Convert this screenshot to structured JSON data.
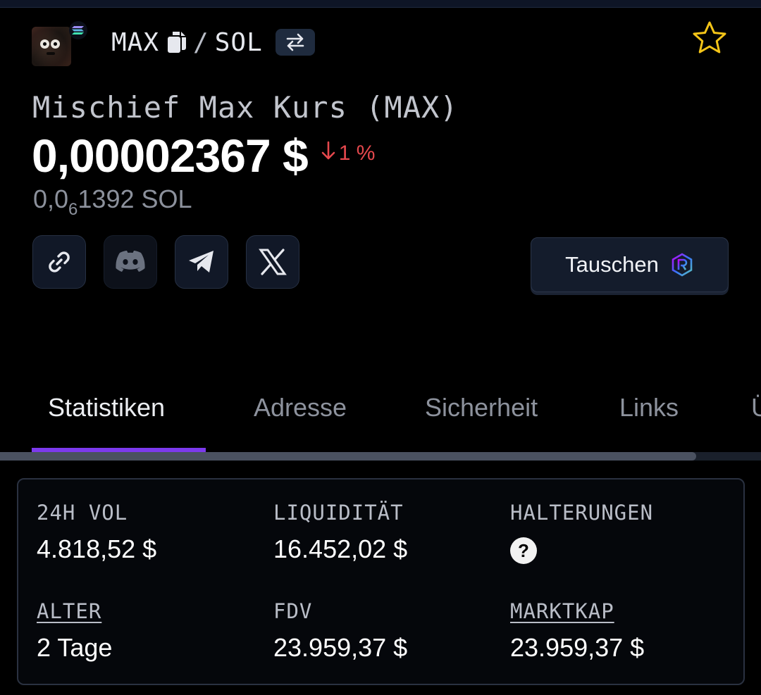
{
  "header": {
    "base_symbol": "MAX",
    "separator": "/",
    "quote_symbol": "SOL"
  },
  "token": {
    "title": "Mischief Max Kurs (MAX)",
    "price": "0,00002367 $",
    "change": "1 %",
    "change_color": "#e5484d",
    "sol_price_prefix": "0,0",
    "sol_price_subscript": "6",
    "sol_price_rest": "1392 SOL"
  },
  "actions": {
    "swap_label": "Tauschen"
  },
  "tabs": [
    {
      "label": "Statistiken",
      "active": true
    },
    {
      "label": "Adresse"
    },
    {
      "label": "Sicherheit"
    },
    {
      "label": "Links"
    },
    {
      "label": "Ü"
    }
  ],
  "stats": {
    "vol24h": {
      "label": "24H VOL",
      "value": "4.818,52 $"
    },
    "liquidity": {
      "label": "LIQUIDITÄT",
      "value": "16.452,02 $"
    },
    "holders": {
      "label": "HALTERUNGEN",
      "value": "?"
    },
    "age": {
      "label": "ALTER",
      "value": "2 Tage"
    },
    "fdv": {
      "label": "FDV",
      "value": "23.959,37 $"
    },
    "marketcap": {
      "label": "MARKTKAP",
      "value": "23.959,37 $"
    }
  },
  "colors": {
    "accent": "#7c3aed",
    "star": "#f5c518",
    "negative": "#e5484d"
  }
}
